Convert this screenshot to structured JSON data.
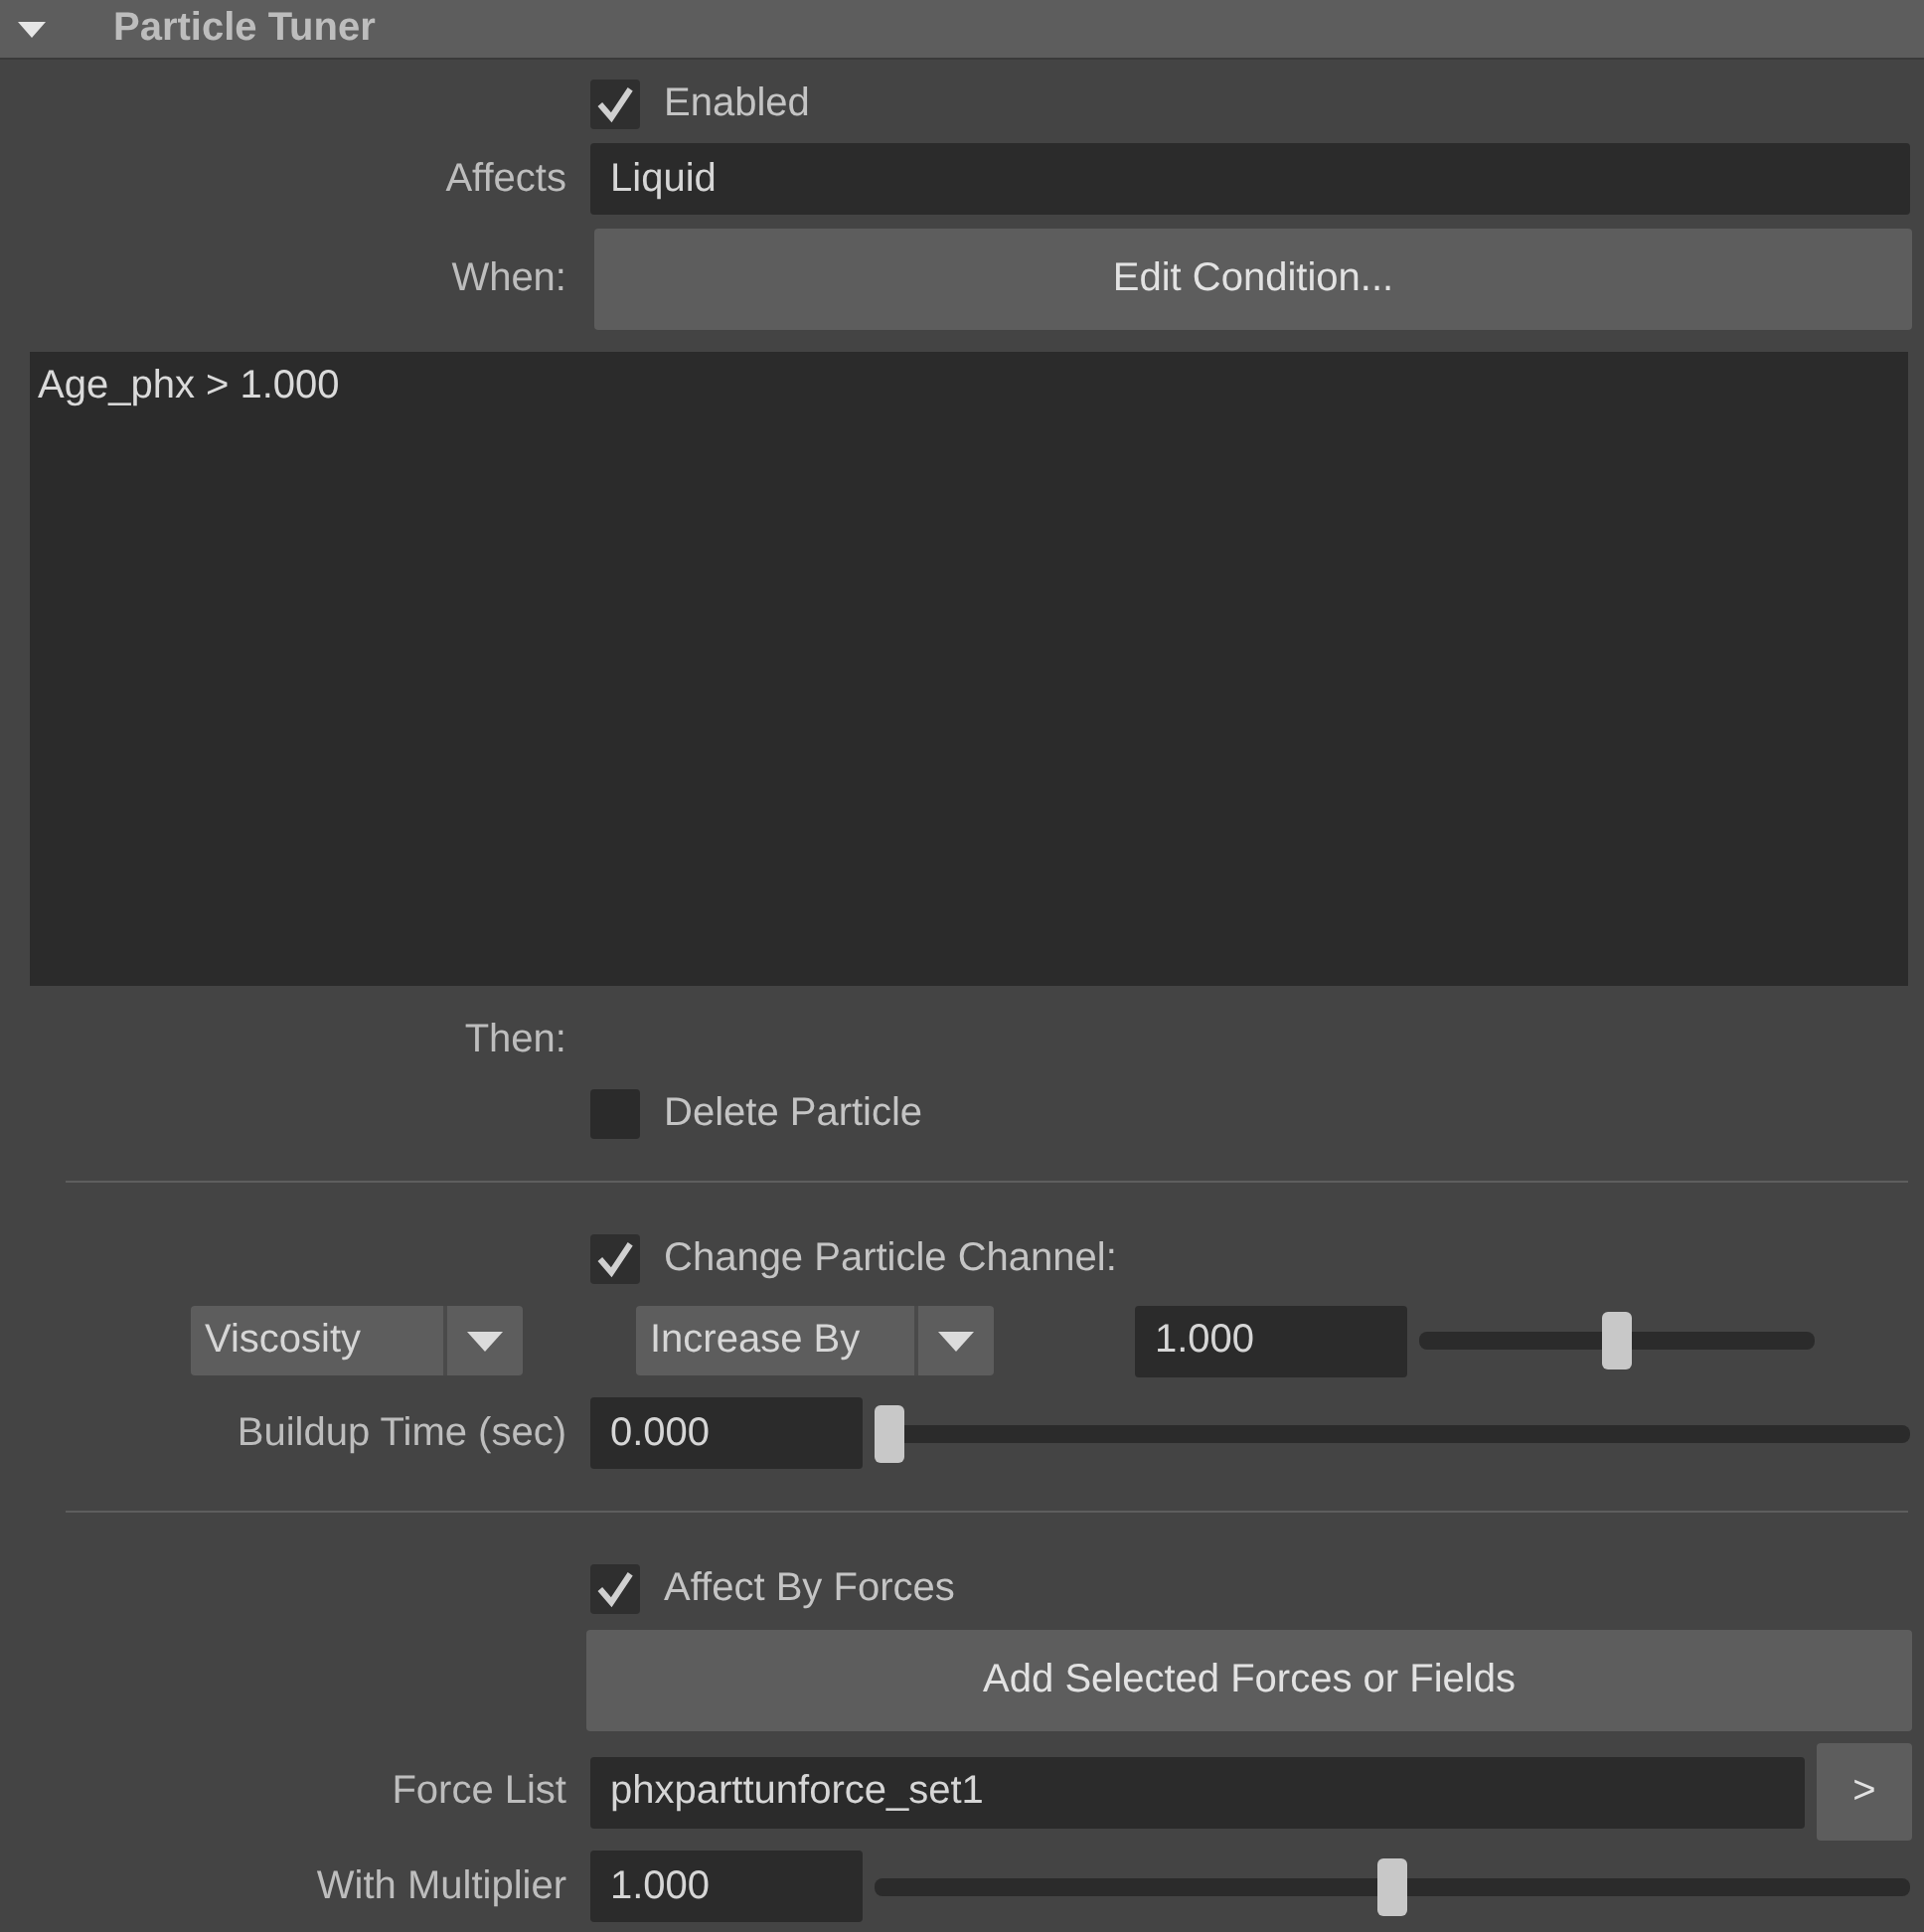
{
  "panel": {
    "title": "Particle Tuner",
    "expanded": true
  },
  "enabled": {
    "label": "Enabled",
    "checked": true
  },
  "affects": {
    "label": "Affects",
    "value": "Liquid"
  },
  "when": {
    "label": "When:",
    "button": "Edit Condition..."
  },
  "condition_text": "Age_phx > 1.000",
  "then_label": "Then:",
  "delete_particle": {
    "label": "Delete Particle",
    "checked": false
  },
  "change_channel": {
    "label": "Change Particle Channel:",
    "checked": true,
    "channel": "Viscosity",
    "operation": "Increase By",
    "value": "1.000",
    "level": 0.5
  },
  "buildup_time": {
    "label": "Buildup Time (sec)",
    "value": "0.000",
    "level": 0
  },
  "affect_by_forces": {
    "label": "Affect By Forces",
    "checked": true
  },
  "add_forces_button": "Add Selected Forces or Fields",
  "force_list": {
    "label": "Force List",
    "value": "phxparttunforce_set1",
    "button": ">"
  },
  "multiplier": {
    "label": "With Multiplier",
    "value": "1.000",
    "level": 0.5
  }
}
